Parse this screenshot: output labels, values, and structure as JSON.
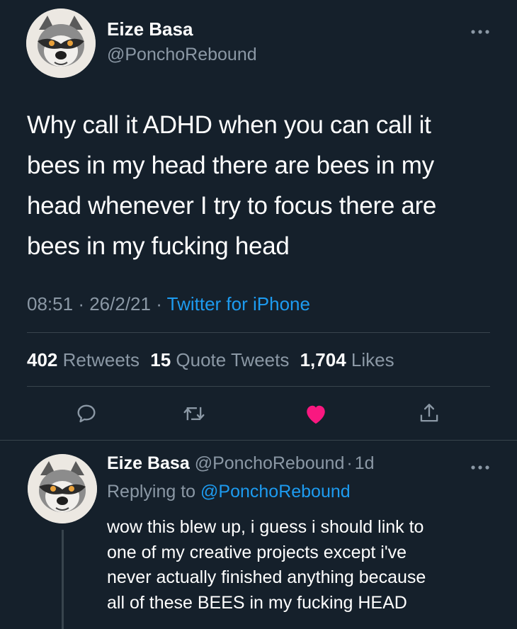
{
  "main_tweet": {
    "author_name": "Eize Basa",
    "author_handle": "@PonchoRebound",
    "text_lines": [
      "Why call it ADHD when you can call it",
      "bees in my head there are bees in my",
      "head whenever I try to focus there are",
      "bees in my fucking head"
    ],
    "time": "08:51",
    "date": "26/2/21",
    "separator": "·",
    "source": "Twitter for iPhone",
    "stats": {
      "retweets_count": "402",
      "retweets_label": "Retweets",
      "quotes_count": "15",
      "quotes_label": "Quote Tweets",
      "likes_count": "1,704",
      "likes_label": "Likes"
    },
    "liked": true
  },
  "reply_tweet": {
    "author_name": "Eize Basa",
    "author_handle": "@PonchoRebound",
    "age": "1d",
    "separator": "·",
    "replying_label": "Replying to",
    "replying_handle": "@PonchoRebound",
    "text_lines": [
      "wow this blew up, i guess i should link to",
      "one of my creative projects except i've",
      "never actually finished anything because",
      "all of these BEES in my fucking HEAD"
    ]
  },
  "icons": {
    "reply": "reply-icon",
    "retweet": "retweet-icon",
    "like": "heart-icon",
    "share": "share-icon",
    "more": "more-icon"
  },
  "colors": {
    "background": "#15202b",
    "accent": "#1d9bf0",
    "like": "#f91880",
    "muted": "#8b98a5",
    "divider": "#38444d"
  }
}
